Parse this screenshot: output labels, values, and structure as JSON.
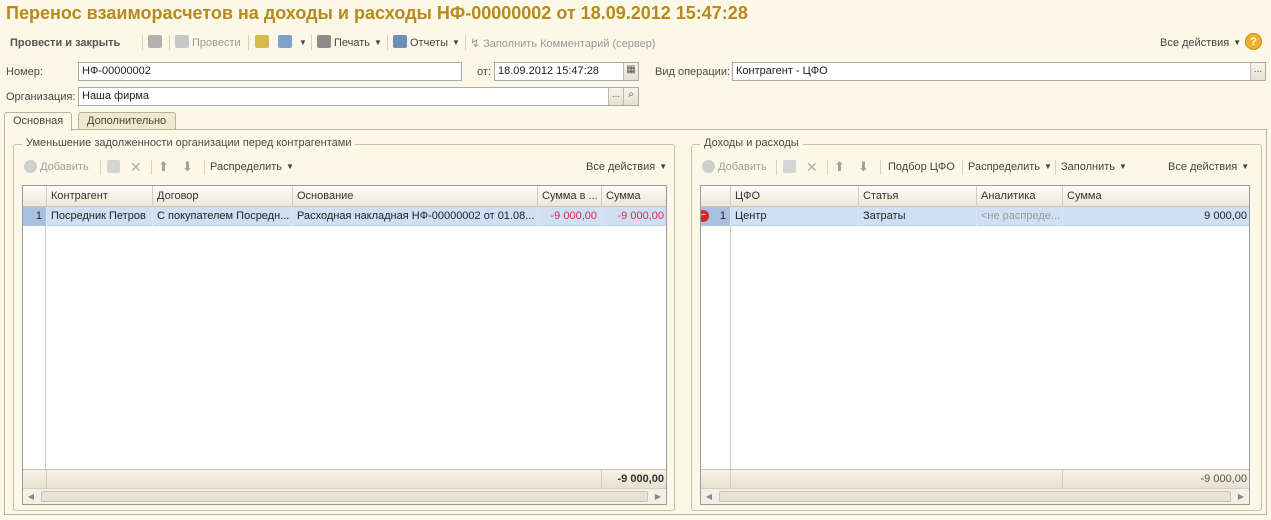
{
  "title": "Перенос взаиморасчетов на доходы и расходы НФ-00000002 от 18.09.2012 15:47:28",
  "toolbar": {
    "post_close": "Провести и закрыть",
    "post": "Провести",
    "print": "Печать",
    "reports": "Отчеты",
    "fill_comment": "Заполнить Комментарий (сервер)",
    "all_actions": "Все действия",
    "help": "?"
  },
  "form": {
    "number_label": "Номер:",
    "number_value": "НФ-00000002",
    "date_label": "от:",
    "date_value": "18.09.2012 15:47:28",
    "optype_label": "Вид операции:",
    "optype_value": "Контрагент - ЦФО",
    "org_label": "Организация:",
    "org_value": "Наша фирма",
    "ellipsis": "..."
  },
  "tabs": [
    "Основная",
    "Дополнительно"
  ],
  "left": {
    "title": "Уменьшение задолженности организации перед контрагентами",
    "toolbar": {
      "add": "Добавить",
      "distribute": "Распределить",
      "all_actions": "Все действия"
    },
    "columns": [
      "Контрагент",
      "Договор",
      "Основание",
      "Сумма в ...",
      "Сумма"
    ],
    "rows": [
      {
        "n": "1",
        "counterparty": "Посредник Петров",
        "contract": "С покупателем Посредн...",
        "basis": "Расходная накладная НФ-00000002 от 01.08...",
        "sum_in": "-9 000,00",
        "sum": "-9 000,00"
      }
    ],
    "total": "-9 000,00"
  },
  "right": {
    "title": "Доходы и расходы",
    "toolbar": {
      "add": "Добавить",
      "pick_cfo": "Подбор ЦФО",
      "distribute": "Распределить",
      "fill": "Заполнить",
      "all_actions": "Все действия"
    },
    "columns": [
      "ЦФО",
      "Статья",
      "Аналитика",
      "Сумма"
    ],
    "rows": [
      {
        "n": "1",
        "cfo": "Центр",
        "item": "Затраты",
        "analytics": "<не распреде...",
        "sum": "9 000,00"
      }
    ],
    "total": "-9 000,00"
  },
  "colors": {
    "title": "#b88a1c",
    "negative": "#e0294a",
    "selected_row": "#cfe0f5"
  }
}
